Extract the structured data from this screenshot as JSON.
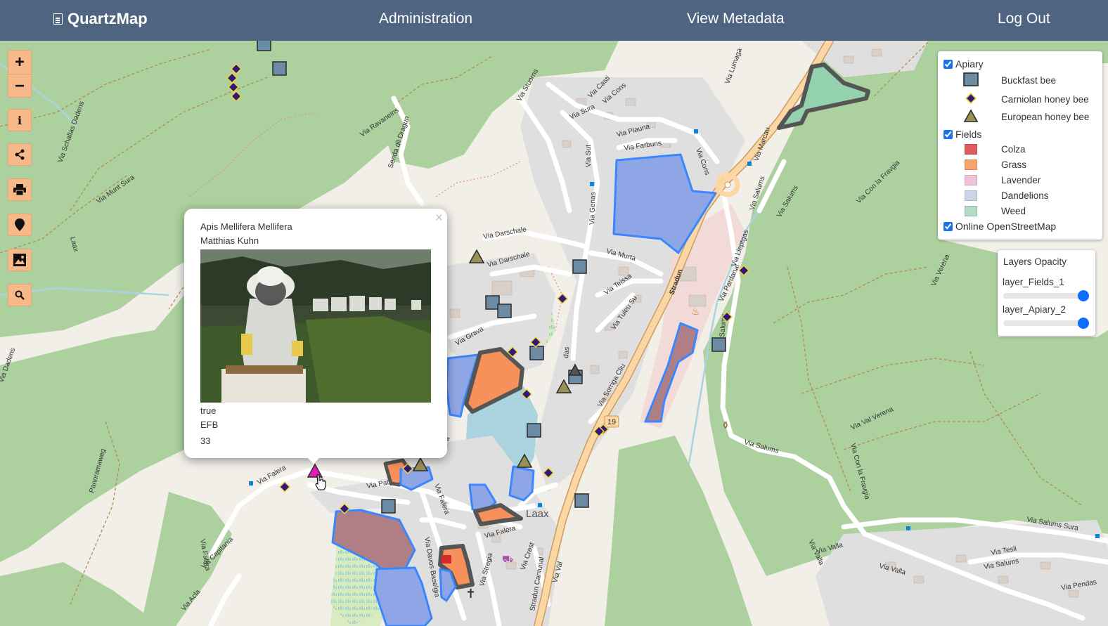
{
  "navbar": {
    "brand": "QuartzMap",
    "links": [
      "Administration",
      "View Metadata",
      "Log Out"
    ]
  },
  "toolbar": {
    "zoom_in": "+",
    "zoom_out": "−",
    "info_icon": "info-icon",
    "share_icon": "share-icon",
    "print_icon": "print-icon",
    "locate_icon": "map-marker-icon",
    "image_icon": "image-icon",
    "search_icon": "search-icon"
  },
  "legend": {
    "apiary": {
      "label": "Apiary",
      "checked": true,
      "items": [
        {
          "label": "Buckfast bee",
          "symbol": "square",
          "color": "#6c8ca6"
        },
        {
          "label": "Carniolan honey bee",
          "symbol": "diamond",
          "color": "#2f1a7a"
        },
        {
          "label": "European honey bee",
          "symbol": "triangle",
          "color": "#9a9155"
        }
      ]
    },
    "fields": {
      "label": "Fields",
      "checked": true,
      "items": [
        {
          "label": "Colza",
          "color": "#e05c5c"
        },
        {
          "label": "Grass",
          "color": "#f7a56b"
        },
        {
          "label": "Lavender",
          "color": "#eec3d8"
        },
        {
          "label": "Dandelions",
          "color": "#ccd4ea"
        },
        {
          "label": "Weed",
          "color": "#b3dcc4"
        }
      ]
    },
    "basemap": {
      "label": "Online OpenStreetMap",
      "checked": true
    }
  },
  "opacity_panel": {
    "title": "Layers Opacity",
    "layers": [
      {
        "label": "layer_Fields_1",
        "value": 1.0
      },
      {
        "label": "layer_Apiary_2",
        "value": 1.0
      }
    ]
  },
  "popup": {
    "species": "Apis Mellifera Mellifera",
    "owner": "Matthias Kuhn",
    "photo": "beekeeper-photo",
    "field1": "true",
    "field2": "EFB",
    "field3": "33",
    "close_label": "×"
  },
  "map_labels": [
    "Via Schallas Dadens",
    "Via Munt Sura",
    "Laax",
    "Via Ravaneins",
    "Senda dil Dragun",
    "Via Stuorns",
    "Via Cons",
    "Via Sura",
    "Via Casti",
    "Via Plauna",
    "Via Farbuns",
    "Via Sut",
    "Via Genas",
    "Via Cons",
    "Via Darschale",
    "Via Darschale",
    "Via Murta",
    "Via Teissa",
    "Via Tuleu Su",
    "Via Grava",
    "Via Sorriga Cliu",
    "Stradun",
    "Via Lieptgas",
    "Via Pardanal",
    "Via Salums",
    "Via Marcau",
    "Via Salums",
    "Via Con la Fravgia",
    "Via Verena",
    "Via Val Verena",
    "Via Con la Fravgia",
    "Via Salums",
    "Via Salums Sura",
    "Via Tesli",
    "Via Salums",
    "Via Valla",
    "Via Valla",
    "Via Pendas",
    "Via Falera",
    "Via Falera",
    "Via Patgada",
    "Via Falera",
    "Laax",
    "Via Falera",
    "Stradun Cantunal",
    "Via Crest",
    "Via Val",
    "Via Stregia",
    "Via Davos Baselgia",
    "Via Capitania",
    "Via Falera",
    "Via Acla",
    "Panoramaweg",
    "Via Dadens",
    "19"
  ]
}
